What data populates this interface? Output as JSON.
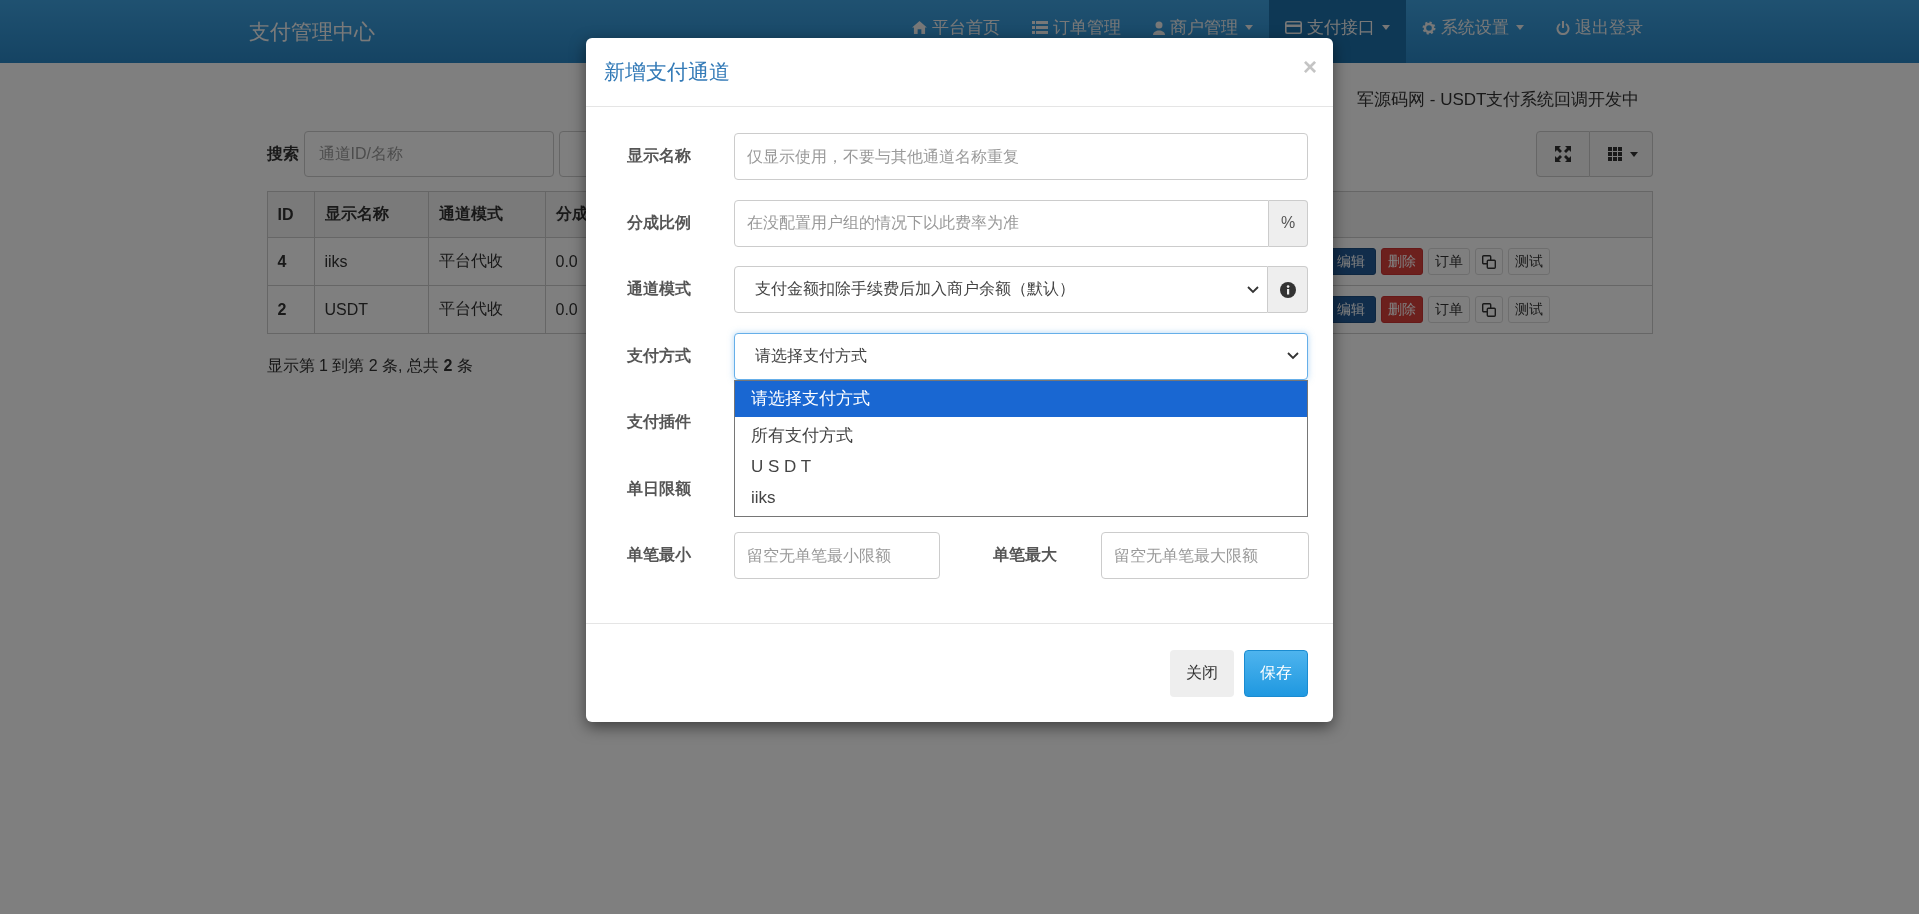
{
  "navbar": {
    "brand": "支付管理中心",
    "items": [
      {
        "label": "平台首页",
        "dropdown": false,
        "selected": false
      },
      {
        "label": "订单管理",
        "dropdown": false,
        "selected": false
      },
      {
        "label": "商户管理",
        "dropdown": true,
        "selected": false
      },
      {
        "label": "支付接口",
        "dropdown": true,
        "selected": true
      },
      {
        "label": "系统设置",
        "dropdown": true,
        "selected": false
      },
      {
        "label": "退出登录",
        "dropdown": false,
        "selected": false
      }
    ]
  },
  "notice": "军源码网 - USDT支付系统回调开发中",
  "search": {
    "label": "搜索",
    "placeholder": "通道ID/名称"
  },
  "table": {
    "columns": [
      "ID",
      "显示名称",
      "通道模式",
      "分成"
    ],
    "rows": [
      {
        "cells": [
          "4",
          "iiks",
          "平台代收",
          "0.0"
        ],
        "actions": [
          {
            "kind": "primary",
            "label": "编辑"
          },
          {
            "kind": "danger",
            "label": "删除"
          },
          {
            "kind": "default",
            "label": "订单"
          },
          {
            "kind": "copy"
          },
          {
            "kind": "default",
            "label": "测试"
          }
        ]
      },
      {
        "cells": [
          "2",
          "USDT",
          "平台代收",
          "0.0"
        ],
        "actions": [
          {
            "kind": "primary",
            "label": "编辑"
          },
          {
            "kind": "danger",
            "label": "删除"
          },
          {
            "kind": "default",
            "label": "订单"
          },
          {
            "kind": "copy"
          },
          {
            "kind": "default",
            "label": "测试"
          }
        ]
      }
    ]
  },
  "pagination": "显示第 1 到第 2 条, 总共 **2** 条",
  "modal": {
    "title": "新增支付通道",
    "close": "×",
    "fields": [
      {
        "kind": "input",
        "label": "显示名称",
        "placeholder": "仅显示使用，不要与其他通道名称重复"
      },
      {
        "kind": "input",
        "label": "分成比例",
        "placeholder": "在没配置用户组的情况下以此费率为准",
        "addon": "%"
      },
      {
        "kind": "select",
        "label": "通道模式",
        "value": "支付金额扣除手续费后加入商户余额（默认）",
        "info_button": true,
        "focused": false
      },
      {
        "kind": "select",
        "label": "支付方式",
        "value": "请选择支付方式",
        "focused": true,
        "expanded": true,
        "options": [
          {
            "label": "请选择支付方式",
            "selected": true
          },
          {
            "label": "所有支付方式",
            "selected": false
          },
          {
            "label": "U S D T",
            "selected": false
          },
          {
            "label": "iiks",
            "selected": false
          }
        ]
      },
      {
        "kind": "covered",
        "label": "支付插件"
      },
      {
        "kind": "covered",
        "label": "单日限额"
      },
      {
        "kind": "pair",
        "items": [
          {
            "label": "单笔最小",
            "placeholder": "留空无单笔最小限额"
          },
          {
            "label": "单笔最大",
            "placeholder": "留空无单笔最大限额"
          }
        ]
      }
    ],
    "buttons": [
      {
        "kind": "default",
        "label": "关闭"
      },
      {
        "kind": "primary",
        "label": "保存"
      }
    ]
  }
}
